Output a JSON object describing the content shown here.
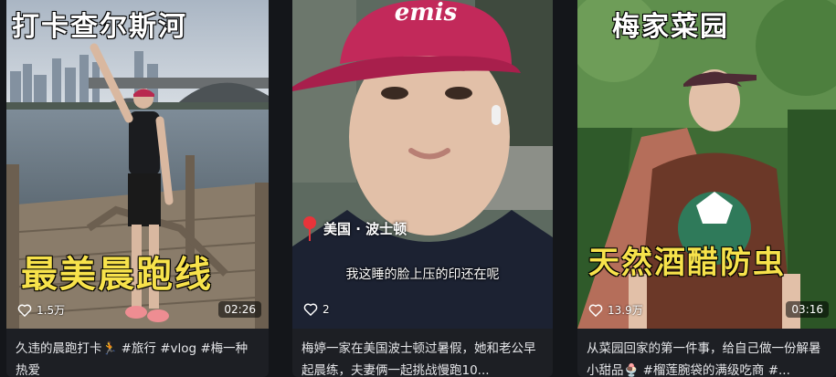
{
  "cards": [
    {
      "overlay_top": "打卡查尔斯河",
      "overlay_main": "最美晨跑线",
      "likes": "1.5万",
      "duration": "02:26",
      "caption": "久违的晨跑打卡🏃 #旅行 #vlog #梅一种热爱"
    },
    {
      "location": "美国 · 波士顿",
      "subtitle": "我这睡的脸上压的印还在呢",
      "likes": "2",
      "duration": "",
      "caption": "梅婷一家在美国波士顿过暑假，她和老公早起晨练，夫妻俩一起挑战慢跑10..."
    },
    {
      "overlay_top": "梅家菜园",
      "overlay_main": "天然酒醋防虫",
      "likes": "13.9万",
      "duration": "03:16",
      "caption": "从菜园回家的第一件事，给自己做一份解暑小甜品🍨 #榴莲腕袋的满级吃商 #..."
    }
  ],
  "colors": {
    "background": "#14161a",
    "overlay_yellow": "#f7e24b",
    "pin_red": "#e8343a"
  },
  "icons": [
    "heart-icon",
    "location-pin-icon"
  ]
}
